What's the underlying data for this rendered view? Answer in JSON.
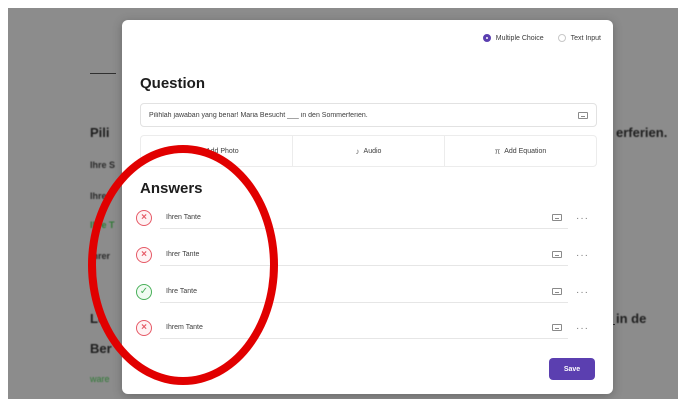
{
  "background": {
    "left_fragments": [
      "Pili",
      "Le",
      "Ber"
    ],
    "right_fragments": [
      "erferien.",
      "in de"
    ],
    "small_lines": [
      "Ihre S",
      "Ihre",
      "Ihre T",
      "Ihrer"
    ],
    "green_line": "ware"
  },
  "modal": {
    "modes": [
      {
        "label": "Multiple Choice",
        "selected": true
      },
      {
        "label": "Text Input",
        "selected": false
      }
    ],
    "question_heading": "Question",
    "question_text": "Pilihlah jawaban yang benar! Maria Besucht ___ in den Sommerferien.",
    "media_buttons": [
      {
        "label": "Add Photo",
        "icon": "photo-icon"
      },
      {
        "label": "Audio",
        "icon": "microphone-icon"
      },
      {
        "label": "Add Equation",
        "icon": "equation-icon"
      }
    ],
    "answers_heading": "Answers",
    "answers": [
      {
        "text": "Ihren Tante",
        "correct": false
      },
      {
        "text": "Ihrer Tante",
        "correct": false
      },
      {
        "text": "Ihre Tante",
        "correct": true
      },
      {
        "text": "Ihrem Tante",
        "correct": false
      }
    ],
    "save_label": "Save"
  },
  "colors": {
    "accent": "#5b3fb0",
    "wrong": "#e65a67",
    "correct": "#49b05a",
    "annotation": "#e10000"
  }
}
